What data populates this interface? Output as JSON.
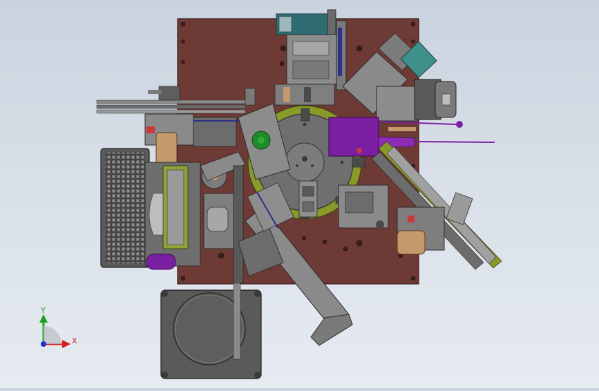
{
  "viewport": {
    "background_top": "#c9d2de",
    "background_bottom": "#e6ebf1"
  },
  "model": {
    "base_plate_color": "#6e3a36",
    "turntable_color": "#6f6f6f",
    "ring_color": "#8a9a2a",
    "accent_purple": "#7b1fa2",
    "accent_green": "#1f8a2a",
    "accent_teal": "#3f8f8a",
    "accent_tan": "#c49a6c"
  },
  "triad": {
    "y_label": "Y",
    "x_label": "X",
    "y_color": "#1ca21c",
    "x_color": "#d42020",
    "z_color": "#2030d0"
  }
}
